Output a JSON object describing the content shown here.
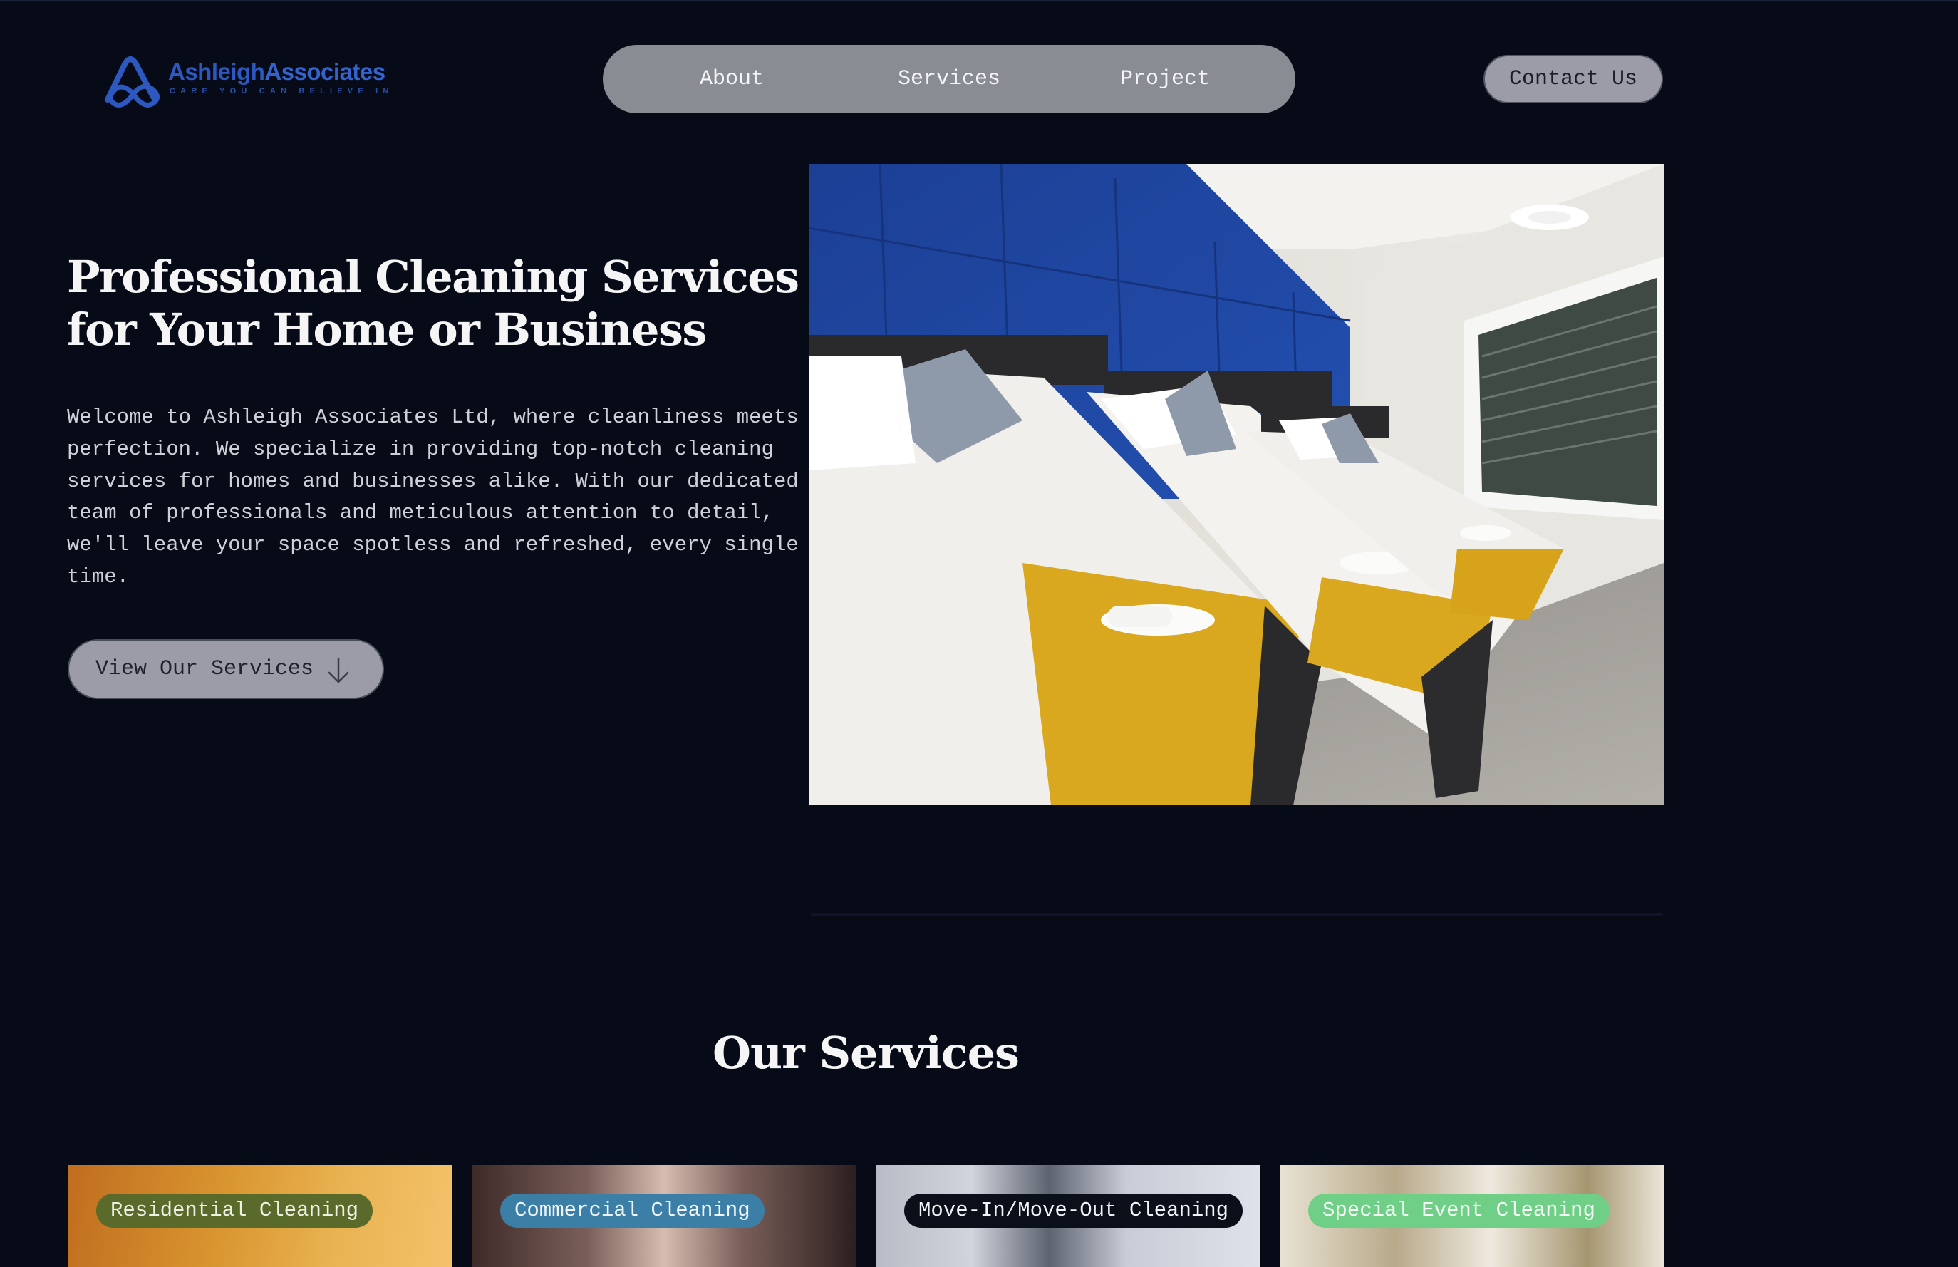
{
  "logo": {
    "brand_first": "Ashleigh",
    "brand_second": "Associates",
    "tagline": "CARE YOU CAN BELIEVE IN"
  },
  "nav": {
    "items": [
      "About",
      "Services",
      "Project"
    ],
    "contact_label": "Contact Us"
  },
  "hero": {
    "title": "Professional Cleaning Services for Your Home or Business",
    "text": "Welcome to Ashleigh Associates Ltd, where cleanliness meets perfection. We specialize in providing top-notch cleaning services for homes and businesses alike. With our dedicated team of professionals and meticulous attention to detail, we'll leave your space spotless and refreshed, every single time.",
    "cta_label": "View Our Services",
    "cta_icon": "arrow-down-icon"
  },
  "services": {
    "title": "Our Services",
    "cards": [
      {
        "label": "Residential Cleaning",
        "color": "#5a6a2b"
      },
      {
        "label": "Commercial Cleaning",
        "color": "#3b7ea6"
      },
      {
        "label": "Move-In/Move-Out Cleaning",
        "color": "#0b0f1a"
      },
      {
        "label": "Special Event Cleaning",
        "color": "#6fcf86"
      }
    ]
  },
  "colors": {
    "background": "#070b18",
    "nav_bg": "#898c93",
    "button_bg": "#9b9ca8",
    "brand_blue": "#2f5cc4"
  }
}
